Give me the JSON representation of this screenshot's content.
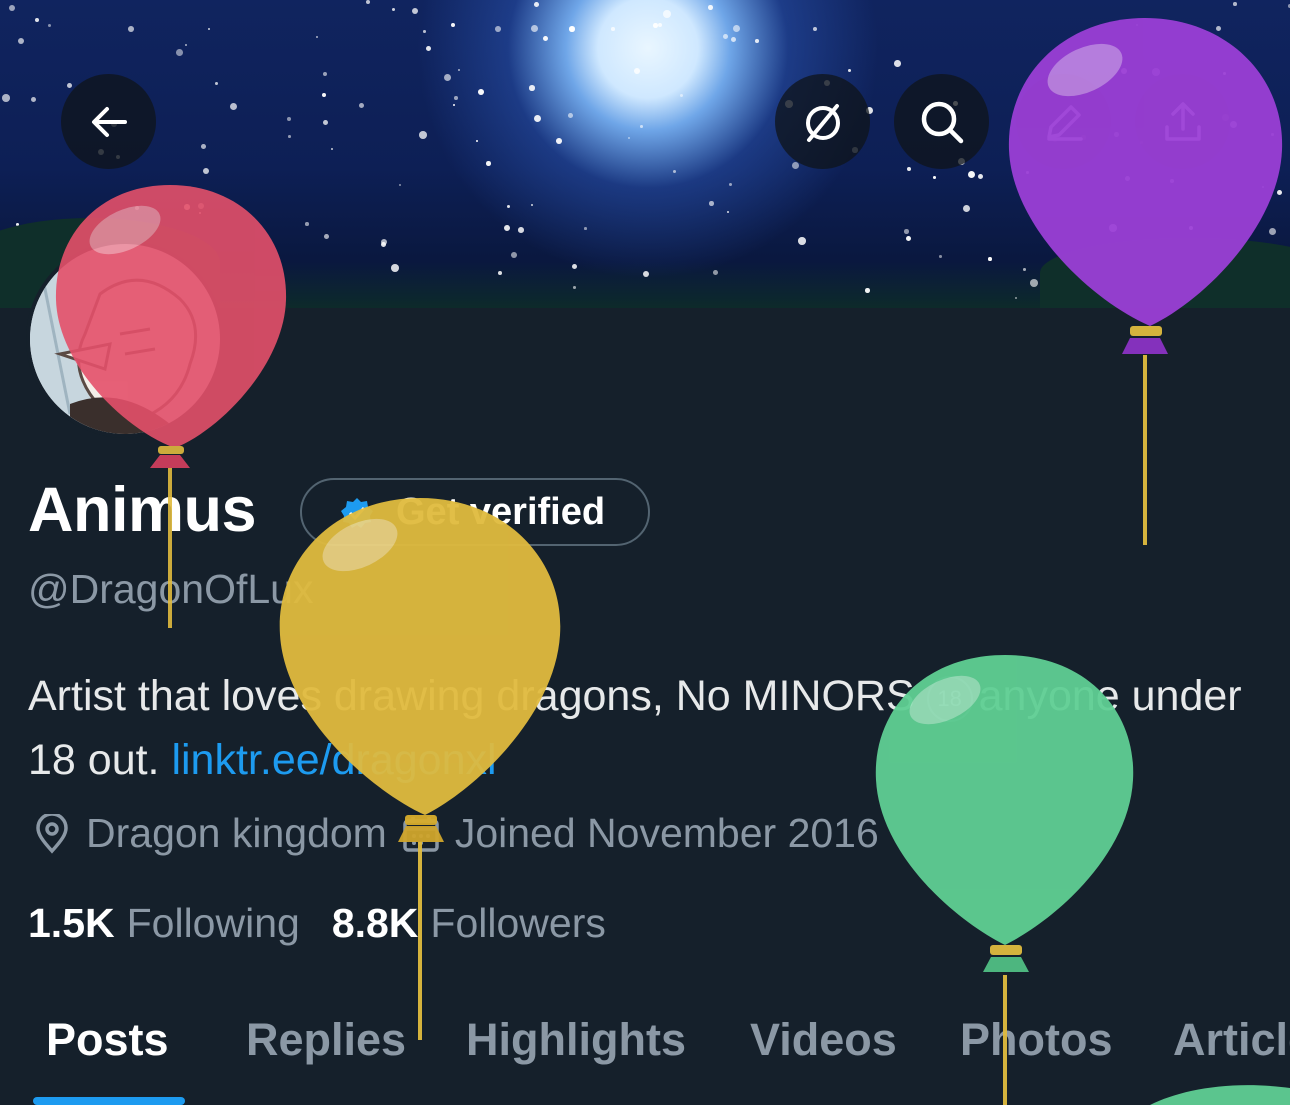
{
  "header": {
    "back_icon": "arrow-left-icon",
    "grok_icon": "slashed-circle-icon",
    "search_icon": "search-icon",
    "edit_icon": "pencil-icon",
    "share_icon": "share-icon"
  },
  "profile": {
    "name": "Animus",
    "get_verified_label": "Get verified",
    "handle": "@DragonOfLux",
    "bio_text_1": "Artist that loves drawing dragons, No MINORS",
    "bio_age_badge": "18",
    "bio_text_2": "anyone under 18 out.",
    "bio_link": "linktr.ee/dragonxl",
    "location": "Dragon kingdom",
    "joined": "Joined November 2016",
    "following_count": "1.5K",
    "following_label": "Following",
    "followers_count": "8.8K",
    "followers_label": "Followers"
  },
  "tabs": [
    {
      "label": "Posts",
      "active": true
    },
    {
      "label": "Replies",
      "active": false
    },
    {
      "label": "Highlights",
      "active": false
    },
    {
      "label": "Videos",
      "active": false
    },
    {
      "label": "Photos",
      "active": false
    },
    {
      "label": "Articles",
      "active": false
    }
  ],
  "colors": {
    "background": "#15202b",
    "accent": "#1d9bf0",
    "muted_text": "#8b98a5",
    "balloon_red": "#e4506a",
    "balloon_purple": "#9b3fd6",
    "balloon_yellow": "#e0bb3e",
    "balloon_green": "#5fcf93"
  }
}
